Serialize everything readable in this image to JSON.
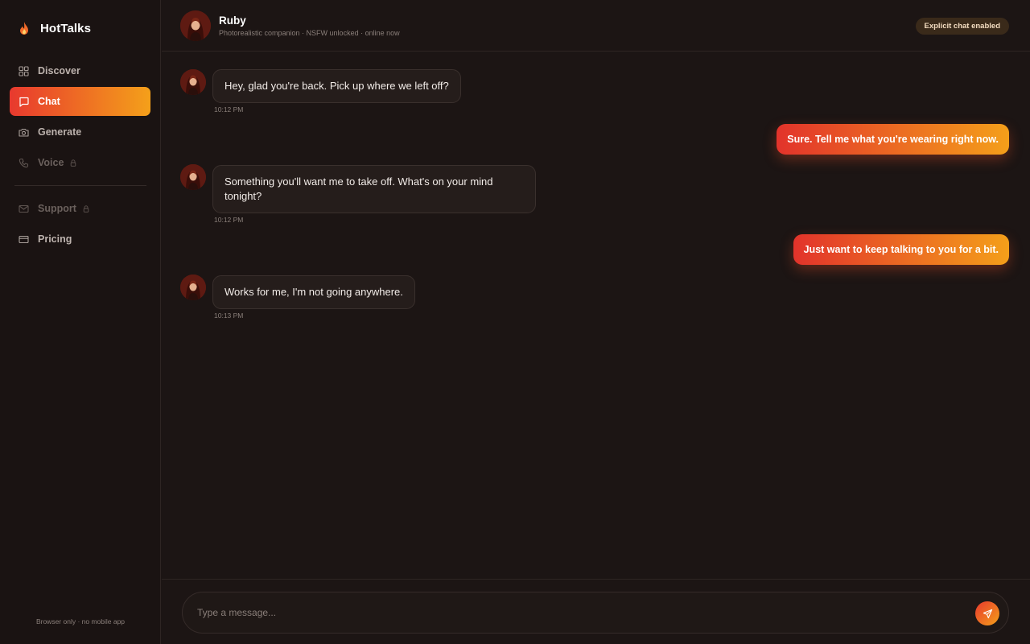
{
  "app": {
    "name": "HotTalks"
  },
  "sidebar": {
    "items": [
      {
        "label": "Discover",
        "icon": "grid-icon",
        "state": "normal"
      },
      {
        "label": "Chat",
        "icon": "chat-bubble-icon",
        "state": "active"
      },
      {
        "label": "Generate",
        "icon": "camera-icon",
        "state": "normal"
      },
      {
        "label": "Voice",
        "icon": "phone-icon",
        "state": "locked"
      },
      {
        "label": "Support",
        "icon": "mail-icon",
        "state": "locked"
      },
      {
        "label": "Pricing",
        "icon": "credit-card-icon",
        "state": "normal"
      }
    ],
    "footer": "Browser only · no mobile app"
  },
  "header": {
    "name": "Ruby",
    "subtitle": "Photorealistic companion · NSFW unlocked · online now",
    "badge": "Explicit chat enabled"
  },
  "messages": [
    {
      "from": "companion",
      "text": "Hey, glad you're back. Pick up where we left off?",
      "time": "10:12 PM"
    },
    {
      "from": "user",
      "text": "Sure. Tell me what you're wearing right now."
    },
    {
      "from": "companion",
      "text": "Something you'll want me to take off. What's on your mind tonight?",
      "time": "10:12 PM"
    },
    {
      "from": "user",
      "text": "Just want to keep talking to you for a bit."
    },
    {
      "from": "companion",
      "text": "Works for me, I'm not going anywhere.",
      "time": "10:13 PM"
    }
  ],
  "composer": {
    "placeholder": "Type a message..."
  },
  "colors": {
    "accent_start": "#e8392e",
    "accent_end": "#f4a01a",
    "background": "#1c1514"
  }
}
